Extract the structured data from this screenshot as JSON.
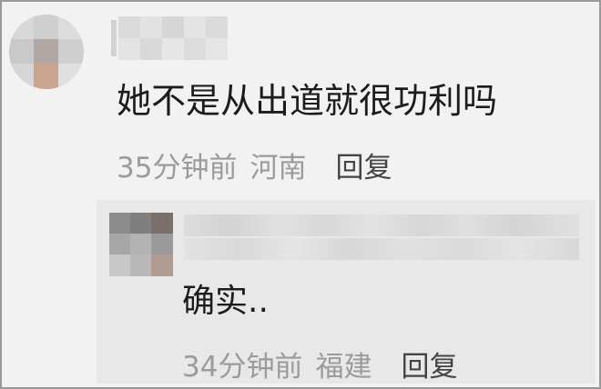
{
  "comment": {
    "text": "她不是从出道就很功利吗",
    "time": "35分钟前",
    "location": "河南",
    "reply_label": "回复"
  },
  "reply": {
    "text": "确实..",
    "time": "34分钟前",
    "location": "福建",
    "reply_label": "回复"
  },
  "colors": {
    "background": "#f2f2f2",
    "reply_background": "#e8e8e8",
    "meta_text": "#9b9b9b",
    "reply_button_text": "#444444",
    "comment_text": "#1c1c1c",
    "border": "#9a9a9a"
  }
}
